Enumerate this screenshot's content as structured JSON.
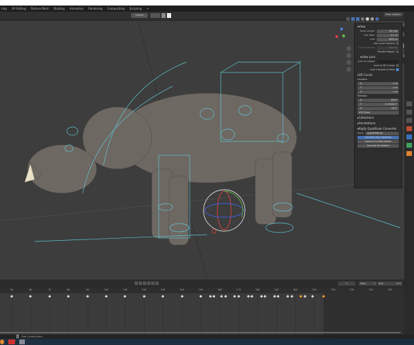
{
  "workspace_tabs": [
    "ting",
    "UV Editing",
    "Texture Paint",
    "Shading",
    "Animation",
    "Rendering",
    "Compositing",
    "Scripting",
    "+"
  ],
  "header": {
    "transform_orientation": "Global",
    "pose_options": "Pose Options"
  },
  "npanel": {
    "tabs": [
      "Item",
      "Tool",
      "View",
      "ARP"
    ],
    "view": {
      "title": "View",
      "focal_length_label": "Focal Length",
      "focal_length": "50 mm",
      "clip_start_label": "Clip Start",
      "clip_start": "0.1 m",
      "end_label": "End",
      "end": "1000 m",
      "use_local_camera": "Use Local Camera",
      "local_camera_label": "Local Camera",
      "local_camera": "Camera",
      "render_region": "Render Region"
    },
    "view_lock": {
      "title": "View Lock",
      "lock_to_object": "Lock to Object",
      "lock_to_3d_cursor": "Lock to 3D Cursor",
      "lock_camera_to_view": "Lock Camera to View",
      "lock_camera_to_view_checked": true
    },
    "cursor": {
      "title": "3D Cursor",
      "location_label": "Location",
      "loc": [
        {
          "axis": "X",
          "value": "0 m"
        },
        {
          "axis": "Y",
          "value": "0 m"
        },
        {
          "axis": "Z",
          "value": "0 m"
        }
      ],
      "rotation_label": "Rotation",
      "rot": [
        {
          "axis": "X",
          "value": "89.6°"
        },
        {
          "axis": "Y",
          "value": "-0.000021°"
        },
        {
          "axis": "Z",
          "value": "78.4°"
        }
      ],
      "mode": "XYZ Euler"
    },
    "collections": "Collections",
    "annotations": "Annotations",
    "rigify": {
      "title": "Rigify Quat/Euler Converter",
      "conv_label": "Conv...",
      "conv_value": "QUATERNION",
      "convert_selected": "Convert Only Selected",
      "convert_current": "Convert Current Action",
      "convert_all": "Convert All Actions"
    }
  },
  "timeline": {
    "current_frame": "0",
    "start_label": "Start",
    "start": "1",
    "end_label": "End",
    "end": "215",
    "ticks": [
      50,
      60,
      70,
      80,
      90,
      100,
      110,
      120,
      130,
      140,
      150,
      160,
      170,
      180,
      190,
      200,
      210,
      220,
      230,
      240,
      250
    ],
    "keyframes": [
      50,
      60,
      70,
      80,
      90,
      100,
      110,
      120,
      130,
      140,
      150,
      155,
      157,
      161,
      163,
      168,
      170,
      175,
      177,
      182,
      184,
      189,
      191,
      196,
      198,
      203,
      205,
      209,
      215
    ],
    "selected_keyframes": [
      203,
      215
    ]
  },
  "status": {
    "hint": "Pose Context Menu"
  },
  "colors": {
    "accent": "#4772b3",
    "keyframe_selected": "#f0a020",
    "bone": "#5fc7d6"
  }
}
